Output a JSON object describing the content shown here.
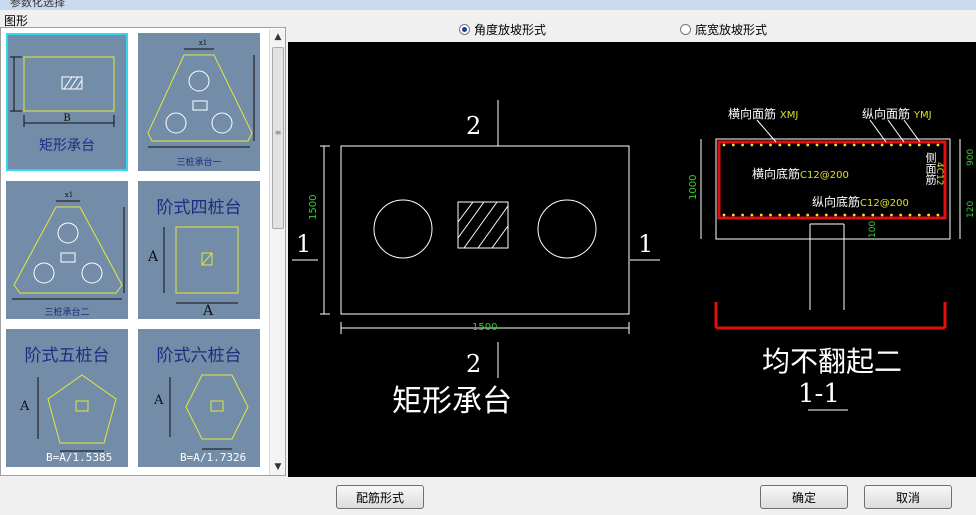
{
  "window": {
    "title": "参数化选择"
  },
  "panel": {
    "label": "图形"
  },
  "thumbnails": [
    {
      "label": "矩形承台",
      "dim": "B"
    },
    {
      "label": "三桩承台一",
      "dim": "x1"
    },
    {
      "label": "三桩承台二",
      "dim": "x1"
    },
    {
      "label": "阶式四桩台",
      "dim": "A"
    },
    {
      "label": "阶式五桩台",
      "dim": "A",
      "formula": "B=A/1.5385"
    },
    {
      "label": "阶式六桩台",
      "dim": "A",
      "formula": "B=A/1.7326"
    }
  ],
  "options": [
    {
      "label": "角度放坡形式",
      "selected": true
    },
    {
      "label": "底宽放坡形式",
      "selected": false
    }
  ],
  "drawing": {
    "plan": {
      "title": "矩形承台",
      "section_mark": "1",
      "section_mark_2": "2",
      "width_dim": "1500",
      "height_dim": "1500"
    },
    "section": {
      "title": "均不翻起二",
      "label": "1-1",
      "top_transverse": "横向面筋",
      "top_transverse_code": "XMJ",
      "top_longitudinal": "纵向面筋",
      "top_longitudinal_code": "YMJ",
      "bottom_transverse": "横向底筋",
      "bottom_transverse_code": "C12@200",
      "bottom_longitudinal": "纵向底筋",
      "bottom_longitudinal_code": "C12@200",
      "side_bar": "侧面筋",
      "side_bar_code": "4C12",
      "height_dim": "1000",
      "dim_900": "900",
      "dim_120": "120",
      "dim_100": "100"
    }
  },
  "buttons": {
    "rebar_form": "配筋形式",
    "ok": "确定",
    "cancel": "取消"
  },
  "colors": {
    "thumb_bg": "#738ca8",
    "selected_border": "#33d6ee",
    "rebar_red": "#e01010",
    "dim_green": "#2fd22f",
    "code_yellow": "#e0e020"
  }
}
